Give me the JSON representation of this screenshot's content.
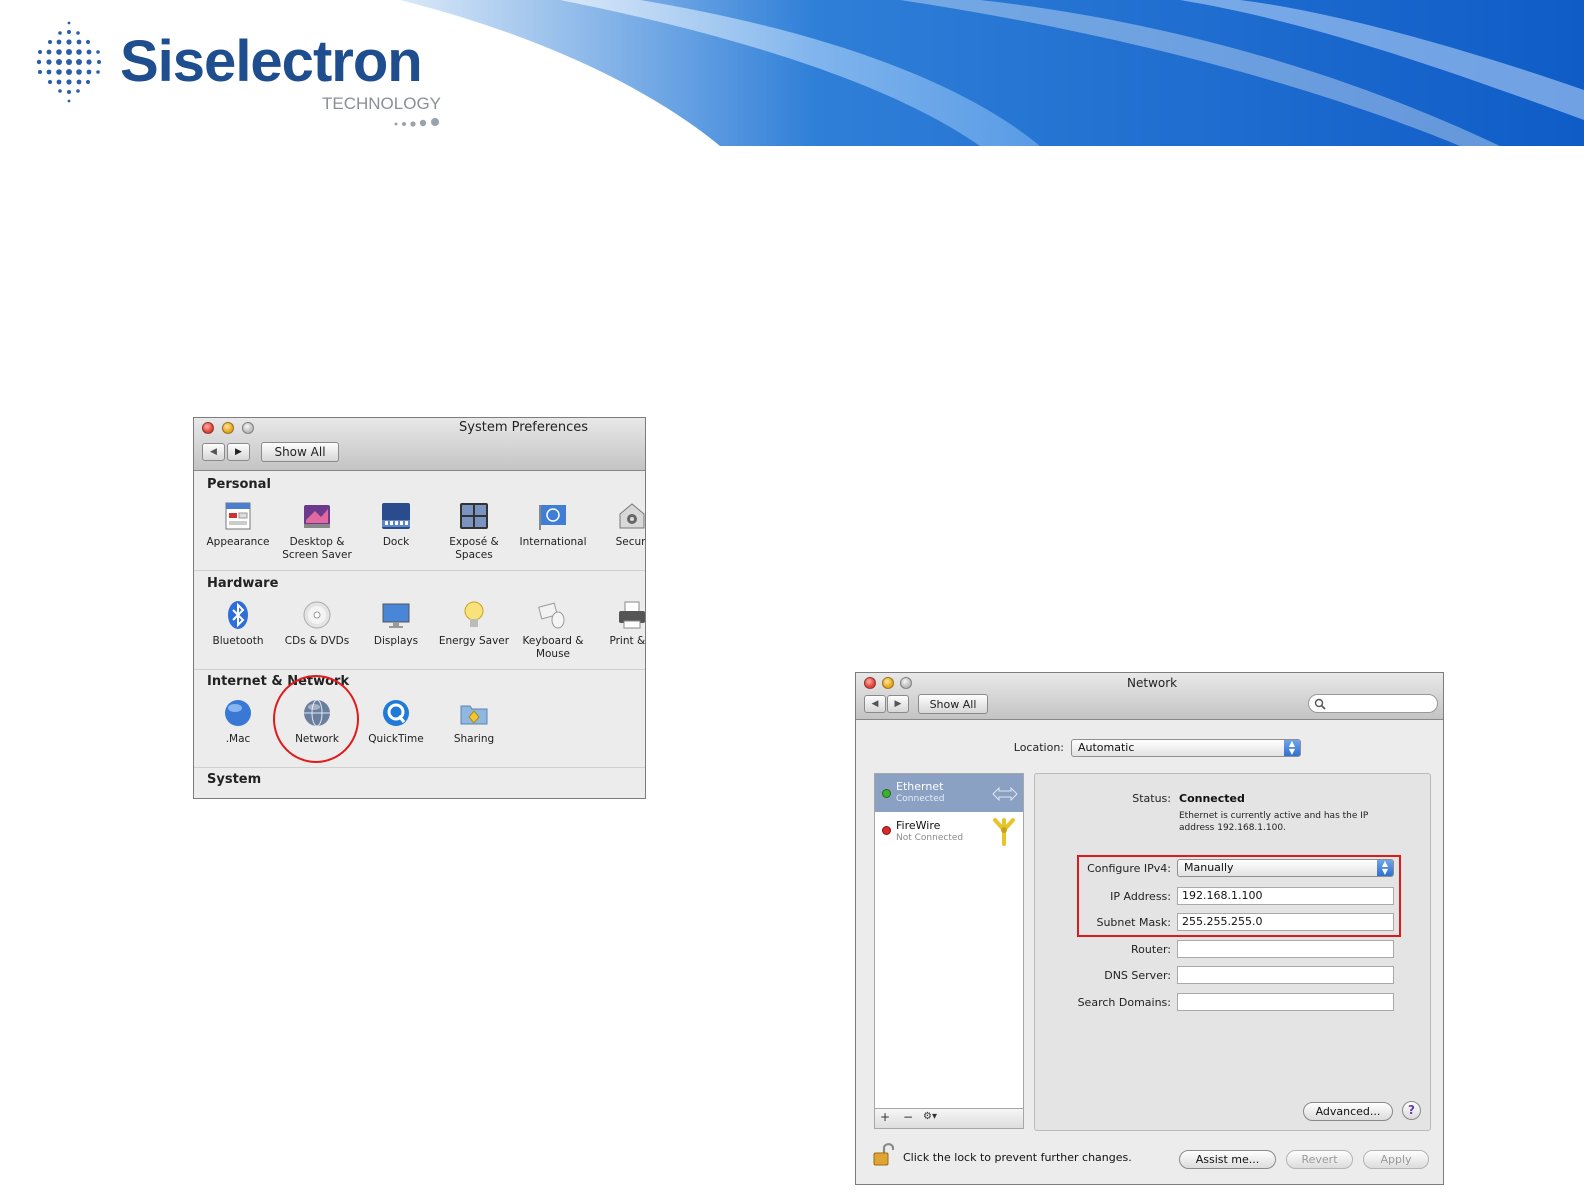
{
  "brand": {
    "name": "Siselectron",
    "tagline": "TECHNOLOGY",
    "color_primary": "#1f4e8f",
    "color_swoosh": "#1e7fdc"
  },
  "system_preferences": {
    "title": "System Preferences",
    "show_all": "Show All",
    "sections": [
      {
        "heading": "Personal",
        "items": [
          {
            "label": "Appearance",
            "icon": "appearance-icon"
          },
          {
            "label": "Desktop & Screen Saver",
            "icon": "desktop-icon"
          },
          {
            "label": "Dock",
            "icon": "dock-icon"
          },
          {
            "label": "Exposé & Spaces",
            "icon": "expose-icon"
          },
          {
            "label": "International",
            "icon": "international-icon"
          },
          {
            "label": "Securi",
            "icon": "security-icon"
          }
        ]
      },
      {
        "heading": "Hardware",
        "items": [
          {
            "label": "Bluetooth",
            "icon": "bluetooth-icon"
          },
          {
            "label": "CDs & DVDs",
            "icon": "cd-icon"
          },
          {
            "label": "Displays",
            "icon": "display-icon"
          },
          {
            "label": "Energy Saver",
            "icon": "bulb-icon"
          },
          {
            "label": "Keyboard & Mouse",
            "icon": "keyboard-icon"
          },
          {
            "label": "Print & F",
            "icon": "printer-icon"
          }
        ]
      },
      {
        "heading": "Internet & Network",
        "items": [
          {
            "label": ".Mac",
            "icon": "mac-globe-icon"
          },
          {
            "label": "Network",
            "icon": "network-globe-icon"
          },
          {
            "label": "QuickTime",
            "icon": "quicktime-icon"
          },
          {
            "label": "Sharing",
            "icon": "sharing-folder-icon"
          }
        ]
      },
      {
        "heading": "System",
        "items": []
      }
    ]
  },
  "network": {
    "title": "Network",
    "show_all": "Show All",
    "search_placeholder": "",
    "location_label": "Location:",
    "location_value": "Automatic",
    "services": [
      {
        "name": "Ethernet",
        "status": "Connected",
        "state_color": "#3fb02c"
      },
      {
        "name": "FireWire",
        "status": "Not Connected",
        "state_color": "#d92a2a"
      }
    ],
    "status_label": "Status:",
    "status_value": "Connected",
    "status_desc": "Ethernet is currently active and has the IP address 192.168.1.100.",
    "configure_label": "Configure IPv4:",
    "configure_value": "Manually",
    "ip_label": "IP Address:",
    "ip_value": "192.168.1.100",
    "mask_label": "Subnet Mask:",
    "mask_value": "255.255.255.0",
    "router_label": "Router:",
    "router_value": "",
    "dns_label": "DNS Server:",
    "dns_value": "",
    "domains_label": "Search Domains:",
    "domains_value": "",
    "advanced": "Advanced...",
    "help": "?",
    "lock_text": "Click the lock to prevent further changes.",
    "assist": "Assist me...",
    "revert": "Revert",
    "apply": "Apply",
    "list_add": "+",
    "list_remove": "−",
    "list_gear": "⚙▾"
  }
}
